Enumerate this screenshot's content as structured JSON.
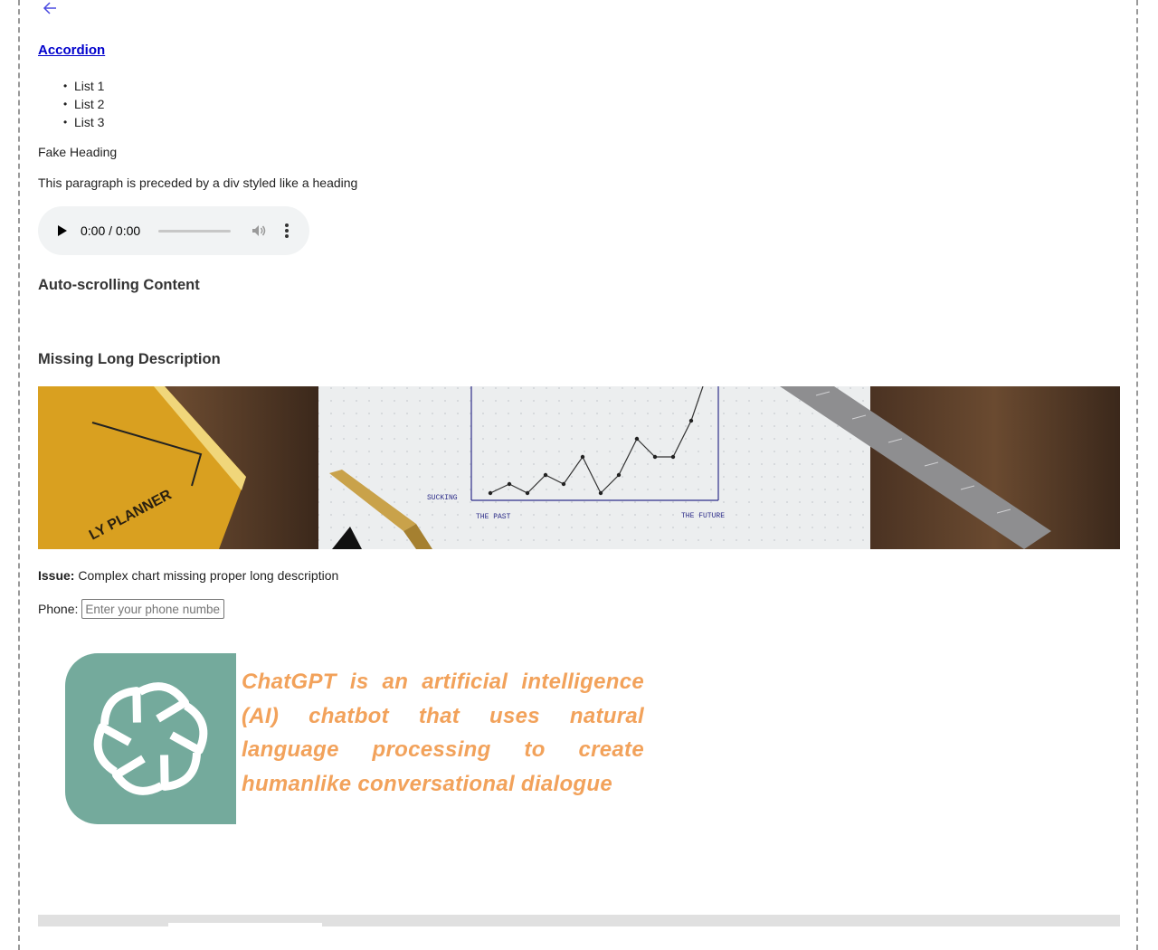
{
  "nav": {
    "back_icon": "arrow-left-icon"
  },
  "accordion": {
    "link_label": "Accordion"
  },
  "list": {
    "items": [
      "List 1",
      "List 2",
      "List 3"
    ]
  },
  "fake_heading": "Fake Heading",
  "paragraph": "This paragraph is preceded by a div styled like a heading",
  "audio": {
    "time": "0:00 / 0:00",
    "play_icon": "play-icon",
    "volume_icon": "volume-icon",
    "menu_icon": "more-vert-icon"
  },
  "sections": {
    "auto_scrolling": "Auto-scrolling Content",
    "missing_long_desc": "Missing Long Description"
  },
  "banner": {
    "chart_labels": {
      "y": "SUCKING",
      "x_left": "THE PAST",
      "x_right": "THE FUTURE"
    },
    "planner_text": "LY PLANNER"
  },
  "issue": {
    "label": "Issue:",
    "text": "Complex chart missing proper long description"
  },
  "phone": {
    "label": "Phone:",
    "placeholder": "Enter your phone number"
  },
  "chatgpt": {
    "logo_icon": "openai-logo-icon",
    "text": "ChatGPT is an artificial intelligence (AI) chatbot that uses natural language processing to create humanlike conversational dialogue"
  },
  "colors": {
    "link": "#0000cc",
    "audio_bg": "#f1f3f4",
    "logo_bg": "#74aa9c",
    "gpt_text": "#f2a25b",
    "back_arrow": "#4a4ae0"
  }
}
